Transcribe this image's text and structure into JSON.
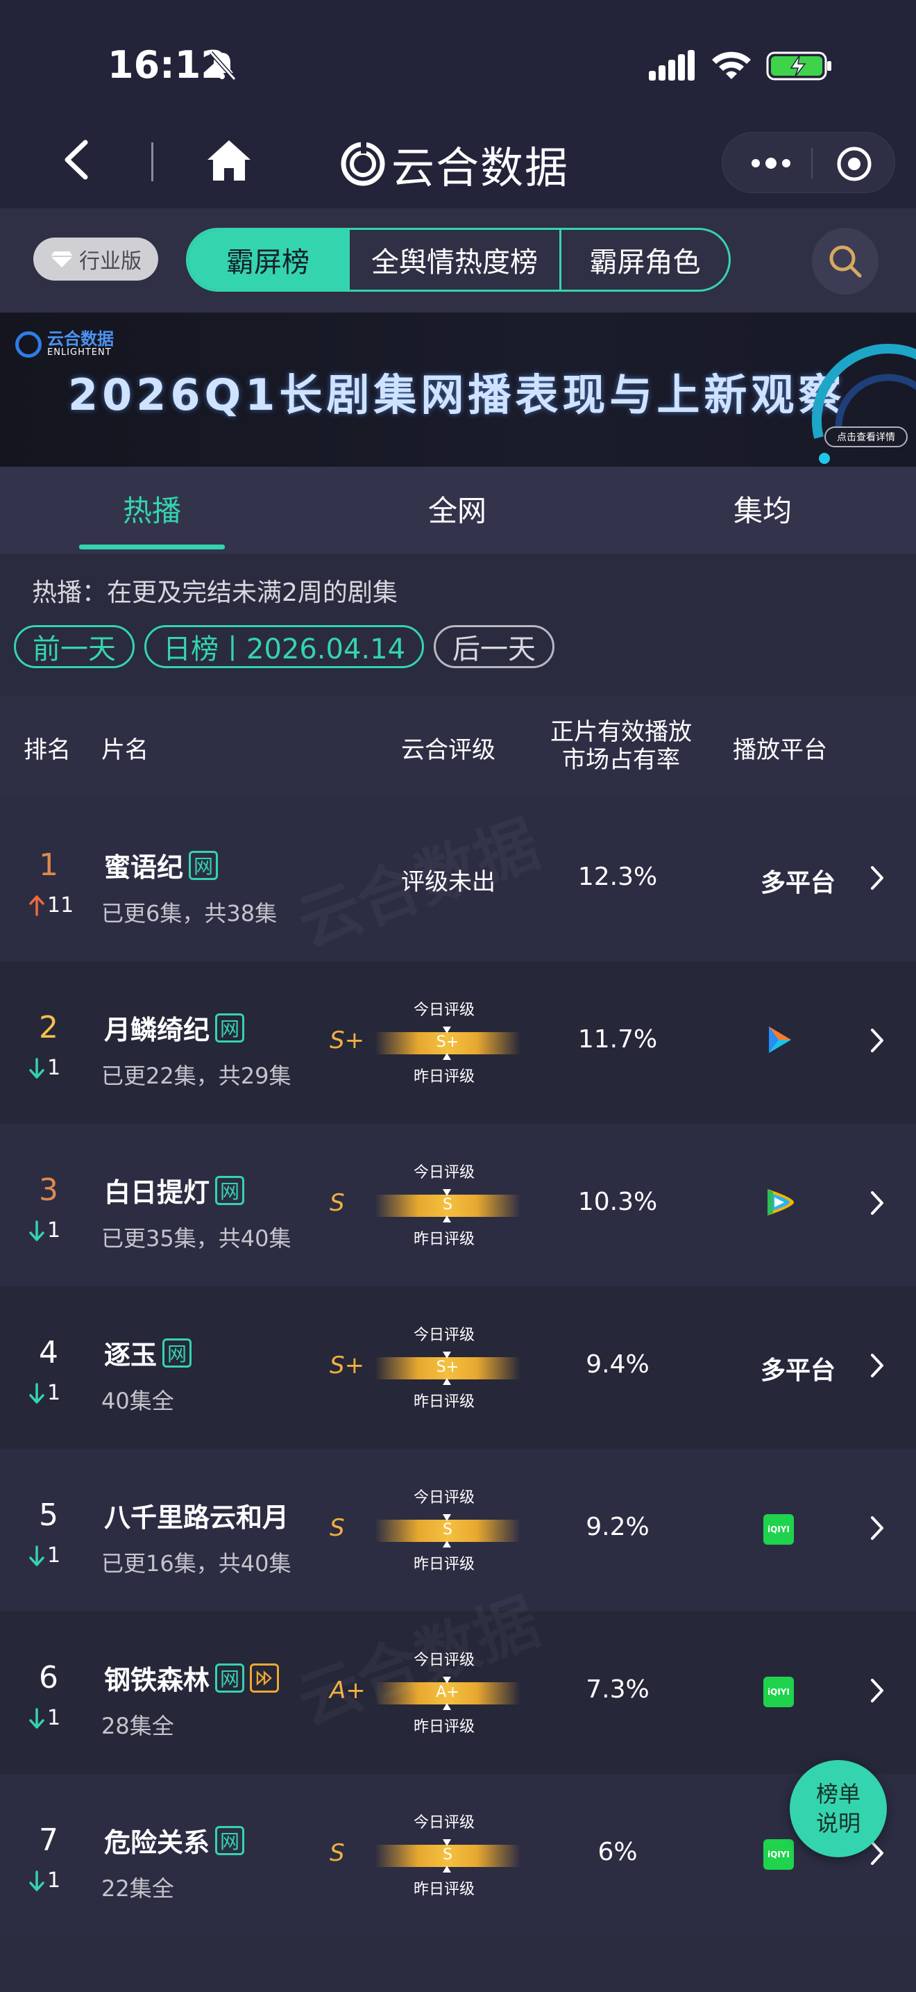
{
  "status": {
    "time": "16:12"
  },
  "nav": {
    "title": "云合数据"
  },
  "filter": {
    "industry_label": "行业版",
    "segments": [
      "霸屏榜",
      "全舆情热度榜",
      "霸屏角色"
    ]
  },
  "banner": {
    "logo_text": "云合数据",
    "logo_sub": "ENLIGHTENT",
    "title": "2026Q1长剧集网播表现与上新观察",
    "cta": "点击查看详情"
  },
  "tabs": [
    "热播",
    "全网",
    "集均"
  ],
  "description": "热播：在更及完结未满2周的剧集",
  "date_nav": {
    "prev": "前一天",
    "current": "日榜丨2026.04.14",
    "next": "后一天"
  },
  "table_header": {
    "rank": "排名",
    "name": "片名",
    "rating": "云合评级",
    "share_line1": "正片有效播放",
    "share_line2": "市场占有率",
    "platform": "播放平台"
  },
  "rating_labels": {
    "today": "今日评级",
    "yesterday": "昨日评级"
  },
  "rows": [
    {
      "rank": "1",
      "trend": "up",
      "change": "11",
      "title": "蜜语纪",
      "tags": [
        "网"
      ],
      "sub": "已更6集，共38集",
      "rating": "",
      "rating_text": "评级未出",
      "share": "12.3%",
      "platform": "多平台",
      "platform_icon": ""
    },
    {
      "rank": "2",
      "trend": "down",
      "change": "1",
      "title": "月鳞绮纪",
      "tags": [
        "网"
      ],
      "sub": "已更22集，共29集",
      "rating": "S+",
      "share": "11.7%",
      "platform": "",
      "platform_icon": "youku-icon"
    },
    {
      "rank": "3",
      "trend": "down",
      "change": "1",
      "title": "白日提灯",
      "tags": [
        "网"
      ],
      "sub": "已更35集，共40集",
      "rating": "S",
      "share": "10.3%",
      "platform": "",
      "platform_icon": "tencent-video-icon"
    },
    {
      "rank": "4",
      "trend": "down",
      "change": "1",
      "title": "逐玉",
      "tags": [
        "网"
      ],
      "sub": "40集全",
      "rating": "S+",
      "share": "9.4%",
      "platform": "多平台",
      "platform_icon": ""
    },
    {
      "rank": "5",
      "trend": "down",
      "change": "1",
      "title": "八千里路云和月",
      "tags": [],
      "sub": "已更16集，共40集",
      "rating": "S",
      "share": "9.2%",
      "platform": "",
      "platform_icon": "iqiyi-icon"
    },
    {
      "rank": "6",
      "trend": "down",
      "change": "1",
      "title": "钢铁森林",
      "tags": [
        "网",
        "play"
      ],
      "sub": "28集全",
      "rating": "A+",
      "share": "7.3%",
      "platform": "",
      "platform_icon": "iqiyi-icon"
    },
    {
      "rank": "7",
      "trend": "down",
      "change": "1",
      "title": "危险关系",
      "tags": [
        "网"
      ],
      "sub": "22集全",
      "rating": "S",
      "share": "6%",
      "platform": "",
      "platform_icon": "iqiyi-icon"
    }
  ],
  "iqiyi_text": "iQIYI",
  "help": {
    "line1": "榜单",
    "line2": "说明"
  },
  "colors": {
    "accent": "#34d4ae",
    "rating": "#f0b040",
    "up": "#f06a3a",
    "down": "#34d4ae"
  }
}
